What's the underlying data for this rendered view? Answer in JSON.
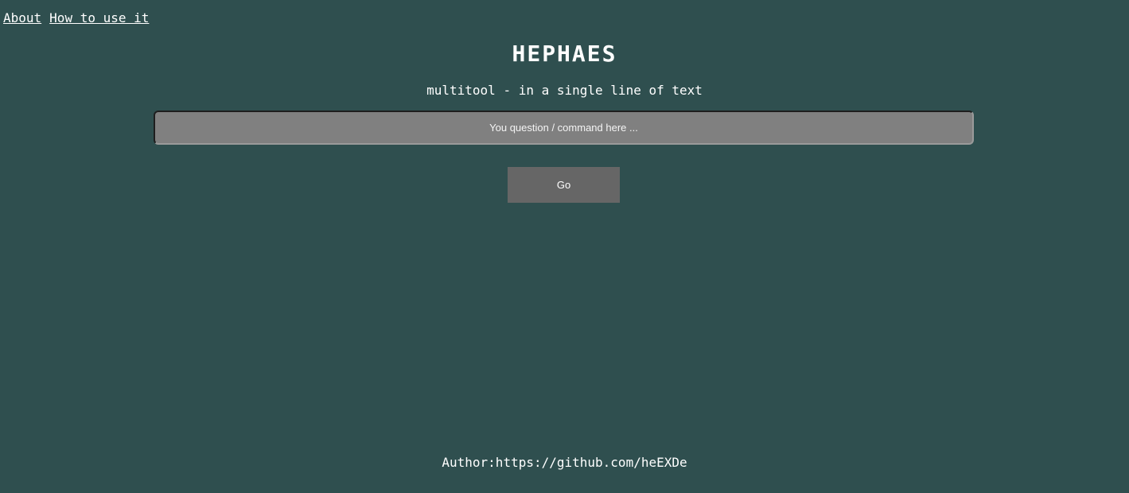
{
  "nav": {
    "about": "About",
    "how_to": "How to use it"
  },
  "logo": "HEPHAES",
  "tagline": "multitool - in a single line of text",
  "command": {
    "value": "",
    "placeholder": "You question / command here ..."
  },
  "go_label": "Go",
  "footer": {
    "author": "Author:https://github.com/heEXDe"
  },
  "colors": {
    "background": "#2f4f4f",
    "input_bg": "#808080",
    "button_bg": "#666666",
    "text": "#ffffff"
  }
}
